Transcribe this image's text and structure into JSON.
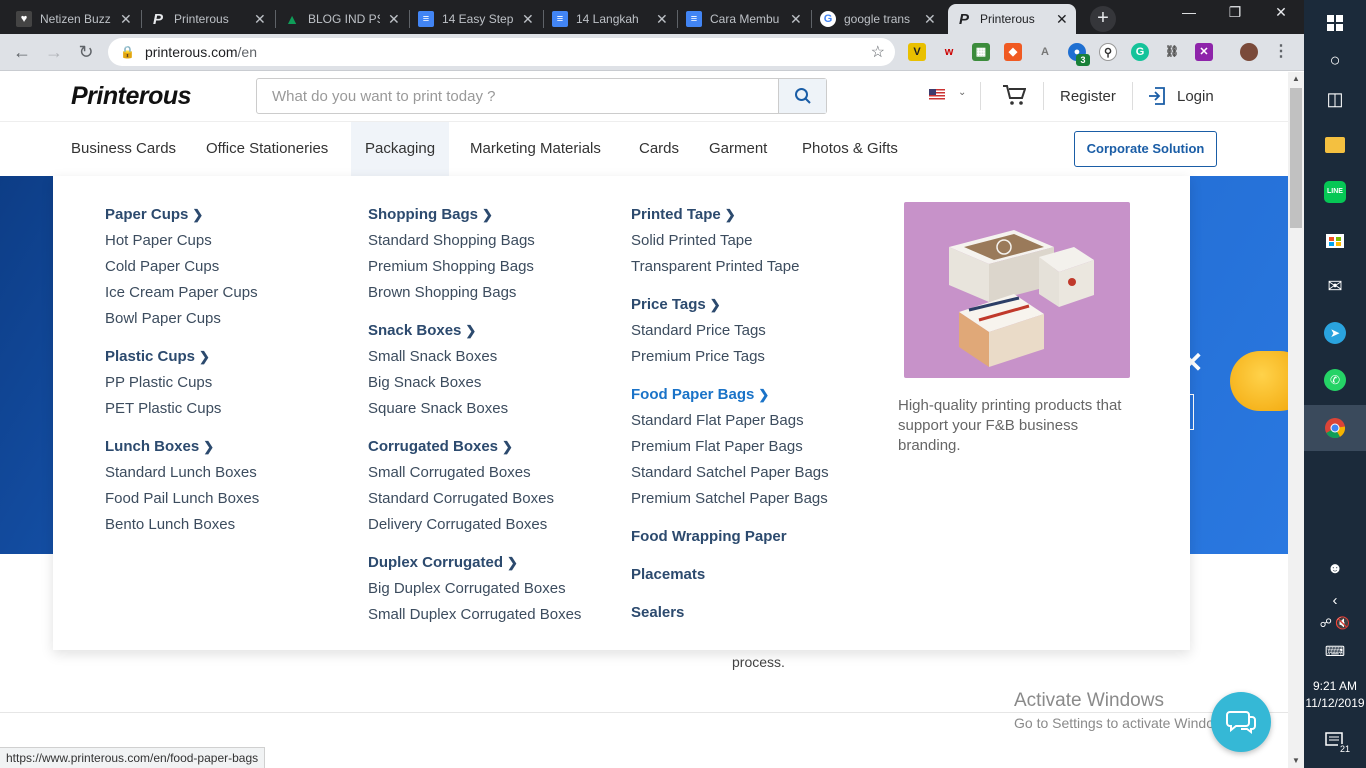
{
  "browser": {
    "tabs": [
      {
        "title": "Netizen Buzz",
        "icon": "netizen-favicon",
        "color": "#333333"
      },
      {
        "title": "Printerous",
        "icon": "printerous-favicon",
        "color": "#202124"
      },
      {
        "title": "BLOG IND PS",
        "icon": "drive-favicon",
        "color": "#f4b400"
      },
      {
        "title": "14 Easy Step",
        "icon": "docs-favicon",
        "color": "#4285f4"
      },
      {
        "title": "14 Langkah",
        "icon": "docs-favicon",
        "color": "#4285f4"
      },
      {
        "title": "Cara Membu",
        "icon": "docs-favicon",
        "color": "#4285f4"
      },
      {
        "title": "google trans",
        "icon": "google-favicon",
        "color": "#ffffff"
      },
      {
        "title": "Printerous",
        "icon": "printerous-favicon",
        "color": "#202124"
      }
    ],
    "url_host": "printerous.com",
    "url_path": "/en",
    "extension_badge": "3",
    "status_url": "https://www.printerous.com/en/food-paper-bags"
  },
  "header": {
    "logo": "Printerous",
    "search_placeholder": "What do you want to print today ?",
    "register": "Register",
    "login": "Login"
  },
  "nav": {
    "categories": [
      "Business Cards",
      "Office Stationeries",
      "Packaging",
      "Marketing Materials",
      "Cards",
      "Garment",
      "Photos & Gifts"
    ],
    "active": "Packaging",
    "corporate": "Corporate Solution"
  },
  "mega": {
    "columns": [
      [
        {
          "title": "Paper Cups",
          "items": [
            "Hot Paper Cups",
            "Cold Paper Cups",
            "Ice Cream Paper Cups",
            "Bowl Paper Cups"
          ]
        },
        {
          "title": "Plastic Cups",
          "items": [
            "PP Plastic Cups",
            "PET Plastic Cups"
          ]
        },
        {
          "title": "Lunch Boxes",
          "items": [
            "Standard Lunch Boxes",
            "Food Pail Lunch Boxes",
            "Bento Lunch Boxes"
          ]
        }
      ],
      [
        {
          "title": "Shopping Bags",
          "items": [
            "Standard Shopping Bags",
            "Premium Shopping Bags",
            "Brown Shopping Bags"
          ]
        },
        {
          "title": "Snack Boxes",
          "items": [
            "Small Snack Boxes",
            "Big Snack Boxes",
            "Square Snack Boxes"
          ]
        },
        {
          "title": "Corrugated Boxes",
          "items": [
            "Small Corrugated Boxes",
            "Standard Corrugated Boxes",
            "Delivery Corrugated Boxes"
          ]
        },
        {
          "title": "Duplex Corrugated",
          "items": [
            "Big Duplex Corrugated Boxes",
            "Small Duplex Corrugated Boxes"
          ]
        }
      ],
      [
        {
          "title": "Printed Tape",
          "items": [
            "Solid Printed Tape",
            "Transparent Printed Tape"
          ]
        },
        {
          "title": "Price Tags",
          "items": [
            "Standard Price Tags",
            "Premium Price Tags"
          ]
        },
        {
          "title": "Food Paper Bags",
          "highlighted": true,
          "items": [
            "Standard Flat Paper Bags",
            "Premium Flat Paper Bags",
            "Standard Satchel Paper Bags",
            "Premium Satchel Paper Bags"
          ]
        },
        {
          "title": "Food Wrapping Paper",
          "nochevron": true,
          "items": []
        },
        {
          "title": "Placemats",
          "nochevron": true,
          "items": []
        },
        {
          "title": "Sealers",
          "nochevron": true,
          "items": []
        }
      ]
    ],
    "promo_text": "High-quality printing products that support your F&B business branding."
  },
  "page": {
    "process_text": "process."
  },
  "watermark": {
    "line1": "Activate Windows",
    "line2": "Go to Settings to activate Windows."
  },
  "taskbar": {
    "time": "9:21 AM",
    "date": "11/12/2019",
    "notifications": "21"
  }
}
